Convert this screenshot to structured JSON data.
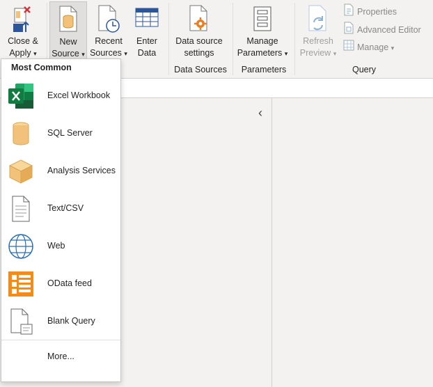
{
  "ribbon": {
    "close_apply": {
      "line1": "Close &",
      "line2": "Apply"
    },
    "new_source": {
      "line1": "New",
      "line2": "Source"
    },
    "recent_sources": {
      "line1": "Recent",
      "line2": "Sources"
    },
    "enter_data": {
      "line1": "Enter",
      "line2": "Data"
    },
    "data_source_settings": {
      "line1": "Data source",
      "line2": "settings"
    },
    "manage_parameters": {
      "line1": "Manage",
      "line2": "Parameters"
    },
    "refresh_preview": {
      "line1": "Refresh",
      "line2": "Preview"
    },
    "properties": "Properties",
    "advanced_editor": "Advanced Editor",
    "manage": "Manage",
    "groups": {
      "query_partial": "ery",
      "data_sources": "Data Sources",
      "parameters": "Parameters",
      "query": "Query"
    },
    "dropdown_arrow": "▾"
  },
  "collapse_glyph": "‹",
  "menu": {
    "header": "Most Common",
    "items": [
      {
        "label": "Excel Workbook",
        "icon": "excel-icon"
      },
      {
        "label": "SQL Server",
        "icon": "database-icon"
      },
      {
        "label": "Analysis Services",
        "icon": "cube-icon",
        "highlighted": true
      },
      {
        "label": "Text/CSV",
        "icon": "document-icon"
      },
      {
        "label": "Web",
        "icon": "globe-icon"
      },
      {
        "label": "OData feed",
        "icon": "odata-icon"
      },
      {
        "label": "Blank Query",
        "icon": "blank-query-icon"
      }
    ],
    "more": "More..."
  },
  "colors": {
    "highlight": "#e04049",
    "excel": "#1e7145",
    "odata": "#f28b1a",
    "db": "#f2c27a"
  }
}
